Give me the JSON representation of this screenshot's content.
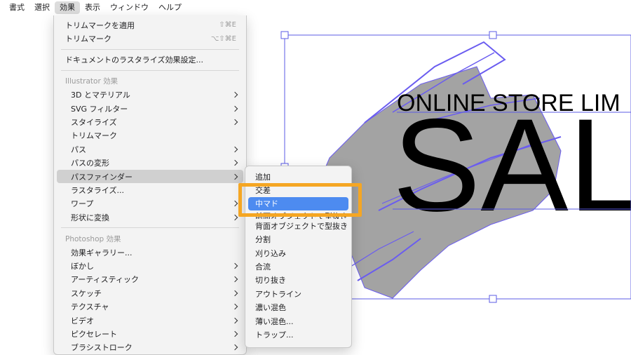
{
  "menubar": {
    "items": [
      {
        "label": "書式",
        "active": false
      },
      {
        "label": "選択",
        "active": false
      },
      {
        "label": "効果",
        "active": true
      },
      {
        "label": "表示",
        "active": false
      },
      {
        "label": "ウィンドウ",
        "active": false
      },
      {
        "label": "ヘルプ",
        "active": false
      }
    ]
  },
  "effects_menu": {
    "apply_trim": {
      "label": "トリムマークを適用",
      "shortcut": "⇧⌘E"
    },
    "trim": {
      "label": "トリムマーク",
      "shortcut": "⌥⇧⌘E"
    },
    "rasterize_settings": "ドキュメントのラスタライズ効果設定...",
    "illustrator_header": "Illustrator 効果",
    "illustrator_items": [
      {
        "label": "3D とマテリアル",
        "submenu": true
      },
      {
        "label": "SVG フィルター",
        "submenu": true
      },
      {
        "label": "スタイライズ",
        "submenu": true
      },
      {
        "label": "トリムマーク",
        "submenu": false
      },
      {
        "label": "パス",
        "submenu": true
      },
      {
        "label": "パスの変形",
        "submenu": true
      },
      {
        "label": "パスファインダー",
        "submenu": true
      },
      {
        "label": "ラスタライズ...",
        "submenu": false
      },
      {
        "label": "ワープ",
        "submenu": true
      },
      {
        "label": "形状に変換",
        "submenu": true
      }
    ],
    "photoshop_header": "Photoshop 効果",
    "photoshop_items": [
      {
        "label": "効果ギャラリー...",
        "submenu": false
      },
      {
        "label": "ぼかし",
        "submenu": true
      },
      {
        "label": "アーティスティック",
        "submenu": true
      },
      {
        "label": "スケッチ",
        "submenu": true
      },
      {
        "label": "テクスチャ",
        "submenu": true
      },
      {
        "label": "ビデオ",
        "submenu": true
      },
      {
        "label": "ピクセレート",
        "submenu": true
      },
      {
        "label": "ブラシストローク",
        "submenu": true
      }
    ]
  },
  "pathfinder_submenu": {
    "items": [
      "追加",
      "交差",
      "中マド",
      "前面オブジェクトで型抜き",
      "背面オブジェクトで型抜き",
      "分割",
      "刈り込み",
      "合流",
      "切り抜き",
      "アウトライン",
      "濃い混色",
      "薄い混色...",
      "トラップ..."
    ],
    "selected": "中マド"
  },
  "artwork": {
    "headline": "ONLINE STORE LIM",
    "big_text": "SAL"
  },
  "colors": {
    "selection": "#5b5be6",
    "highlight_frame": "#f5a623",
    "selected_item": "#4d8bf0",
    "brush_fill": "#a3a3a3",
    "brush_stroke": "#6a5cf0"
  }
}
